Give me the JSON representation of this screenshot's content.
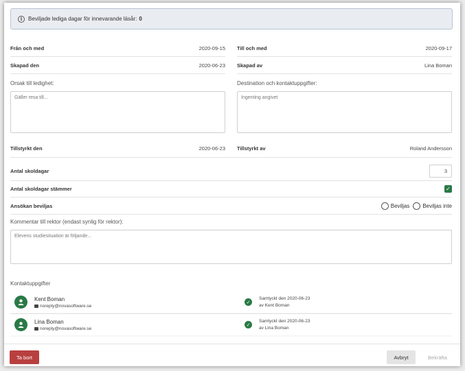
{
  "banner": {
    "icon": "info-icon",
    "text": "Beviljade lediga dagar för innevarande läsår:",
    "value": "0"
  },
  "dates": {
    "from_label": "Från och med",
    "from_value": "2020-09-15",
    "to_label": "Till och med",
    "to_value": "2020-09-17",
    "created_label": "Skapad den",
    "created_value": "2020-06-23",
    "created_by_label": "Skapad av",
    "created_by_value": "Lina Boman"
  },
  "reason": {
    "label": "Orsak till ledighet:",
    "placeholder": "Gäller resa till..."
  },
  "destination": {
    "label": "Destination och kontaktuppgifter:",
    "value": "Ingenting angivet"
  },
  "approval": {
    "approved_label": "Tillstyrkt den",
    "approved_value": "2020-06-23",
    "approved_by_label": "Tillstyrkt av",
    "approved_by_value": "Roland Andersson"
  },
  "school_days": {
    "label": "Antal skoldagar",
    "value": "3"
  },
  "school_days_match": {
    "label": "Antal skoldagar stämmer",
    "checked": true
  },
  "grant": {
    "label": "Ansökan beviljas",
    "options": [
      "Beviljas",
      "Beviljas inte"
    ]
  },
  "comment": {
    "label": "Kommentar till rektor (endast synlig för rektor):",
    "placeholder": "Elevens studiesituation är följande..."
  },
  "contacts": {
    "title": "Kontaktuppgifter",
    "items": [
      {
        "name": "Kent Boman",
        "email": "noreply@novasoftware.se",
        "consent_line1": "Samtyckt den 2020-06-23",
        "consent_line2": "av Kent Boman"
      },
      {
        "name": "Lina Boman",
        "email": "noreply@novasoftware.se",
        "consent_line1": "Samtyckt den 2020-06-23",
        "consent_line2": "av Lina Boman"
      }
    ]
  },
  "footer": {
    "delete_label": "Ta bort",
    "cancel_label": "Avbryt",
    "confirm_label": "Bekräfta"
  },
  "colors": {
    "accent_green": "#2a7a45",
    "danger_red": "#b93f3f",
    "banner_bg": "#e9ecf1"
  }
}
